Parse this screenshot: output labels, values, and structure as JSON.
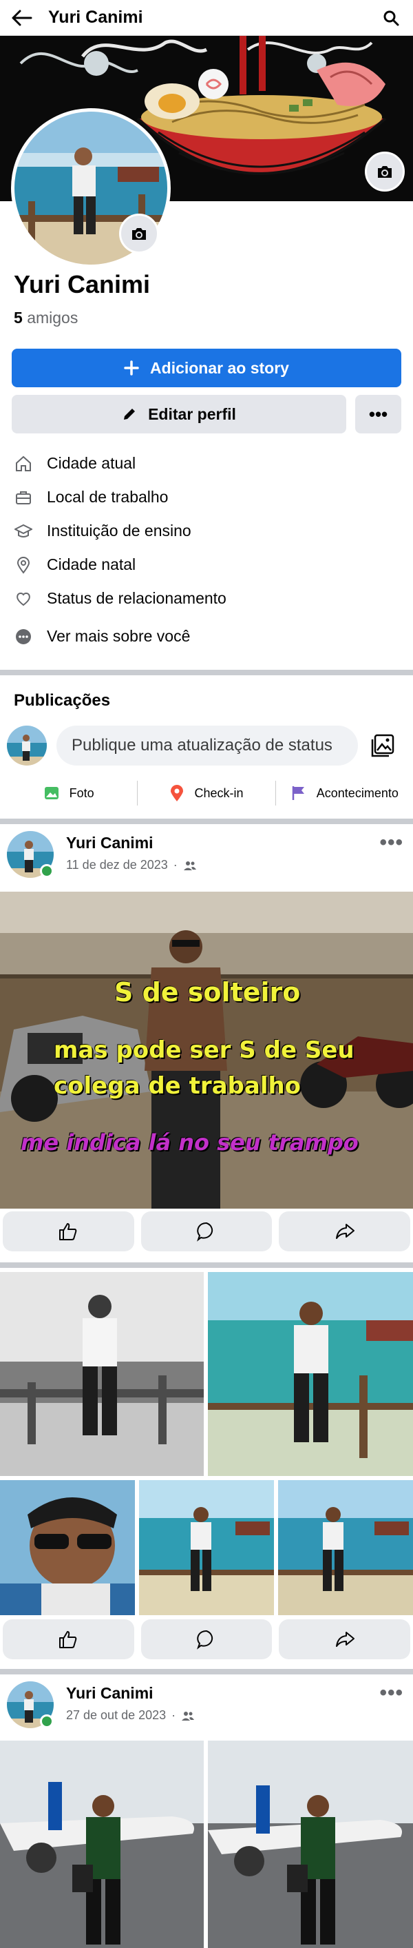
{
  "header": {
    "title": "Yuri Canimi"
  },
  "profile": {
    "name": "Yuri Canimi",
    "friends_count": "5",
    "friends_label": "amigos"
  },
  "buttons": {
    "add_story": "Adicionar ao story",
    "edit_profile": "Editar perfil",
    "more": "•••"
  },
  "details": {
    "current_city": "Cidade atual",
    "workplace": "Local de trabalho",
    "education": "Instituição de ensino",
    "hometown": "Cidade natal",
    "relationship": "Status de relacionamento",
    "see_more": "Ver mais sobre você"
  },
  "publications": {
    "title": "Publicações",
    "status_placeholder": "Publique uma atualização de status",
    "actions": {
      "photo": "Foto",
      "checkin": "Check-in",
      "event": "Acontecimento"
    }
  },
  "posts": [
    {
      "author": "Yuri Canimi",
      "date": "11 de dez de 2023",
      "meme_lines": [
        "S de solteiro",
        "mas pode ser S de Seu",
        "colega de trabalho",
        "me indica lá no seu trampo"
      ]
    },
    {
      "author": "Yuri Canimi",
      "date": ""
    },
    {
      "author": "Yuri Canimi",
      "date": "27 de out de 2023"
    }
  ],
  "colors": {
    "primary": "#1b74e4",
    "online": "#31a24c",
    "meme_yellow": "#f1f23a",
    "meme_purple": "#c230c9"
  },
  "icons": [
    "back-arrow-icon",
    "search-icon",
    "camera-icon",
    "plus-icon",
    "pencil-icon",
    "home-icon",
    "briefcase-icon",
    "graduation-cap-icon",
    "location-pin-icon",
    "heart-icon",
    "dots-circle-icon",
    "photo-gallery-icon",
    "friends-icon",
    "like-icon",
    "comment-icon",
    "share-icon"
  ]
}
